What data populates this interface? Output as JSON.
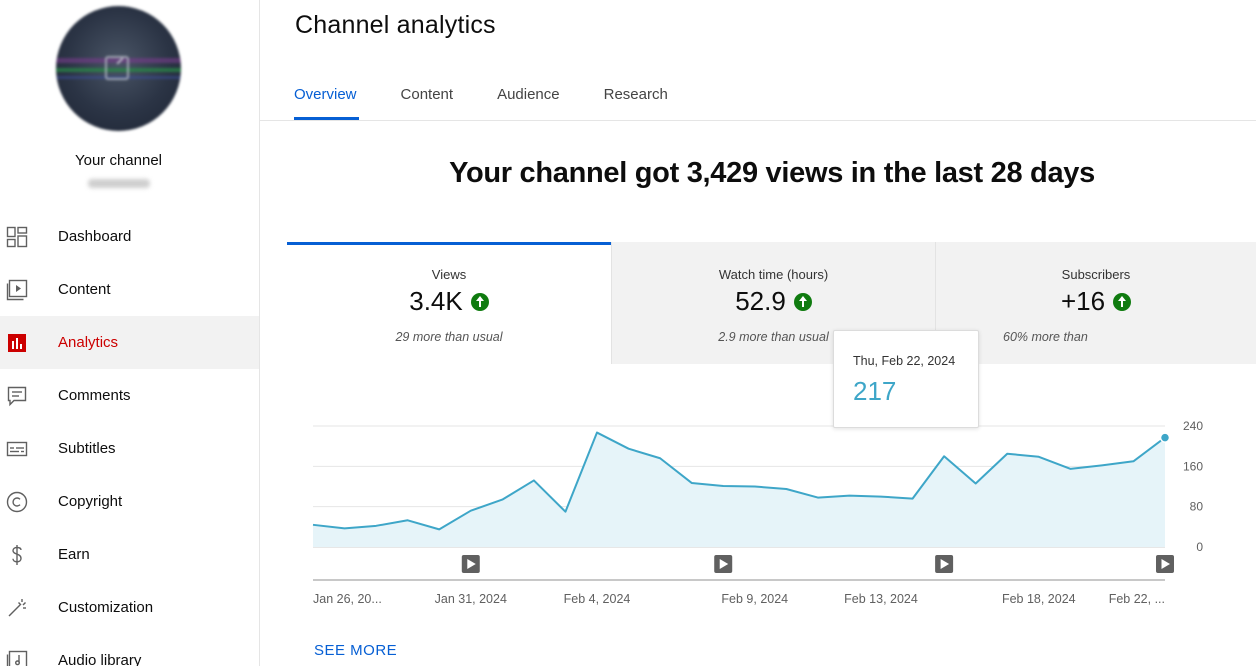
{
  "sidebar": {
    "channel_name": "Your channel",
    "items": [
      {
        "label": "Dashboard",
        "icon": "dashboard-icon"
      },
      {
        "label": "Content",
        "icon": "content-icon"
      },
      {
        "label": "Analytics",
        "icon": "analytics-icon",
        "active": true
      },
      {
        "label": "Comments",
        "icon": "comments-icon"
      },
      {
        "label": "Subtitles",
        "icon": "subtitles-icon"
      },
      {
        "label": "Copyright",
        "icon": "copyright-icon"
      },
      {
        "label": "Earn",
        "icon": "earn-icon"
      },
      {
        "label": "Customization",
        "icon": "customization-icon"
      },
      {
        "label": "Audio library",
        "icon": "audio-library-icon"
      }
    ]
  },
  "header": {
    "title": "Channel analytics",
    "tabs": [
      {
        "label": "Overview",
        "active": true
      },
      {
        "label": "Content"
      },
      {
        "label": "Audience"
      },
      {
        "label": "Research"
      }
    ]
  },
  "summary": {
    "headline": "Your channel got 3,429 views in the last 28 days"
  },
  "metrics": [
    {
      "label": "Views",
      "value": "3.4K",
      "trend": "up",
      "sub": "29 more than usual"
    },
    {
      "label": "Watch time (hours)",
      "value": "52.9",
      "trend": "up",
      "sub": "2.9 more than usual"
    },
    {
      "label": "Subscribers",
      "value": "+16",
      "trend": "up",
      "sub": "60% more than"
    }
  ],
  "tooltip": {
    "date": "Thu, Feb 22, 2024",
    "value": "217"
  },
  "see_more": "SEE MORE",
  "colors": {
    "accent": "#065fd4",
    "active_nav": "#cc0000",
    "line": "#3ea6c8",
    "area": "#e6f4f9",
    "trend_up": "#0f7b0f"
  },
  "chart_data": {
    "type": "area",
    "x": [
      "Jan 26, 2024",
      "Jan 27, 2024",
      "Jan 28, 2024",
      "Jan 29, 2024",
      "Jan 30, 2024",
      "Jan 31, 2024",
      "Feb 1, 2024",
      "Feb 2, 2024",
      "Feb 3, 2024",
      "Feb 4, 2024",
      "Feb 5, 2024",
      "Feb 6, 2024",
      "Feb 7, 2024",
      "Feb 8, 2024",
      "Feb 9, 2024",
      "Feb 10, 2024",
      "Feb 11, 2024",
      "Feb 12, 2024",
      "Feb 13, 2024",
      "Feb 14, 2024",
      "Feb 15, 2024",
      "Feb 16, 2024",
      "Feb 17, 2024",
      "Feb 18, 2024",
      "Feb 19, 2024",
      "Feb 20, 2024",
      "Feb 21, 2024",
      "Feb 22, 2024"
    ],
    "values": [
      44,
      37,
      42,
      53,
      35,
      72,
      94,
      132,
      70,
      227,
      195,
      176,
      127,
      121,
      120,
      115,
      98,
      102,
      100,
      96,
      180,
      126,
      185,
      179,
      155,
      162,
      170,
      217
    ],
    "ylim": [
      0,
      240
    ],
    "yticks": [
      "0",
      "80",
      "160",
      "240"
    ],
    "xtick_labels": [
      "Jan 26, 20...",
      "Jan 31, 2024",
      "Feb 4, 2024",
      "Feb 9, 2024",
      "Feb 13, 2024",
      "Feb 18, 2024",
      "Feb 22, ..."
    ],
    "xtick_indices": [
      0,
      5,
      9,
      14,
      18,
      23,
      27
    ],
    "markers_at_indices": [
      5,
      13,
      20,
      27
    ],
    "grid": true,
    "highlight_index": 27
  }
}
